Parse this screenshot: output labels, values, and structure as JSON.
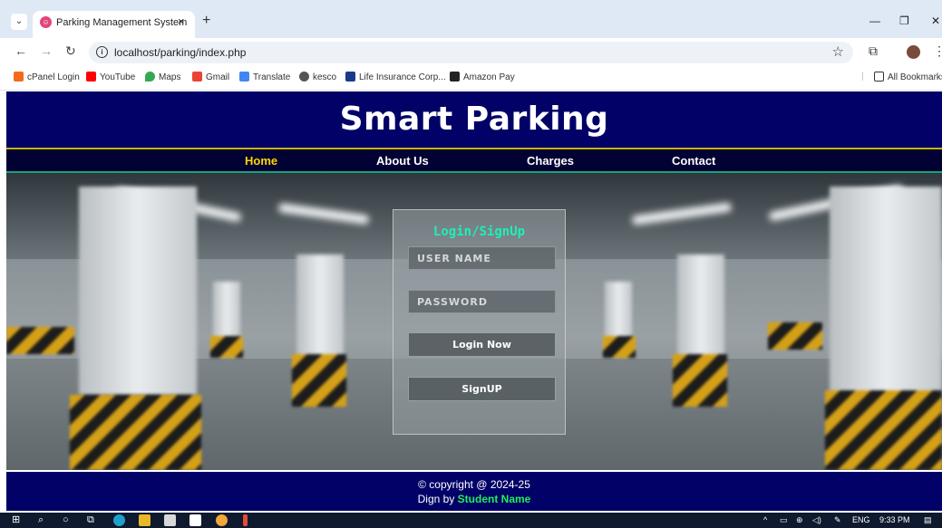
{
  "browser": {
    "tab_title": "Parking Management System",
    "tab_close": "×",
    "new_tab": "+",
    "url": "localhost/parking/index.php",
    "bookmarks": [
      {
        "label": "cPanel Login",
        "icon": "cpanel-icon",
        "color": "#f26b1d"
      },
      {
        "label": "YouTube",
        "icon": "youtube-icon",
        "color": "#ff0000"
      },
      {
        "label": "Maps",
        "icon": "maps-icon",
        "color": "#34a853"
      },
      {
        "label": "Gmail",
        "icon": "gmail-icon",
        "color": "#ea4335"
      },
      {
        "label": "Translate",
        "icon": "translate-icon",
        "color": "#4285f4"
      },
      {
        "label": "kesco",
        "icon": "kesco-icon",
        "color": "#555555"
      },
      {
        "label": "Life Insurance Corp...",
        "icon": "lic-icon",
        "color": "#1a3a8a"
      },
      {
        "label": "Amazon Pay",
        "icon": "amazon-icon",
        "color": "#222222"
      }
    ],
    "all_bookmarks": "All Bookmarks"
  },
  "site": {
    "title": "Smart Parking",
    "nav": [
      {
        "label": "Home",
        "active": true
      },
      {
        "label": "About Us",
        "active": false
      },
      {
        "label": "Charges",
        "active": false
      },
      {
        "label": "Contact",
        "active": false
      }
    ],
    "login": {
      "title": "Login/SignUp",
      "username_placeholder": "USER NAME",
      "password_placeholder": "PASSWORD",
      "login_button": "Login Now",
      "signup_button": "SignUP"
    },
    "footer": {
      "copyright": "© copyright @ 2024-25",
      "design_prefix": "Dign by",
      "student_name": "Student Name"
    }
  },
  "taskbar": {
    "language": "ENG",
    "time": "9:33 PM"
  },
  "colors": {
    "header_bg": "#010167",
    "nav_active": "#ffd700",
    "login_title": "#1df0b4",
    "footer_name": "#1df05a"
  }
}
